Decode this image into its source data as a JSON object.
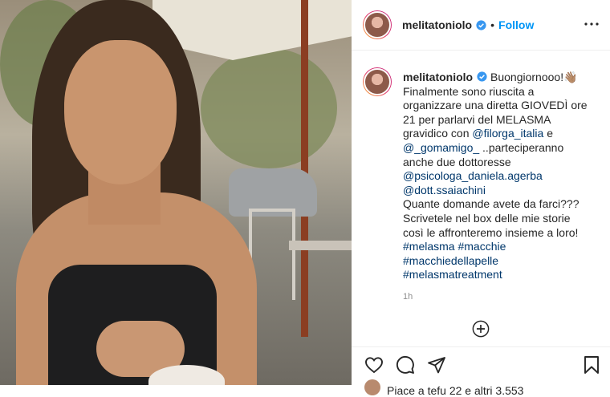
{
  "post": {
    "username": "melitatoniolo",
    "follow_label": "Follow",
    "dot": "•",
    "caption": {
      "username": "melitatoniolo",
      "line1_text": " Buongiornooo!👋🏽",
      "line2": "Finalmente sono riuscita a",
      "line3": "organizzare una diretta GIOVEDÌ ore",
      "line4": "21 per parlarvi del MELASMA",
      "line5_pre": "gravidico con ",
      "mention1": "@filorga_italia",
      "line5_post": " e",
      "mention2": "@_gomamigo_",
      "line6_post": " ..parteciperanno",
      "line7": "anche due dottoresse",
      "mention3": "@psicologa_daniela.agerba",
      "mention4": "@dott.ssaiachini",
      "line10": "Quante domande avete da farci???",
      "line11": "Scrivetele nel box delle mie storie",
      "line12": "così le affronteremo insieme a loro!",
      "hashtag1": "#melasma",
      "hashtag2": "#macchie",
      "hashtag3": "#macchiedellapelle",
      "hashtag4": "#melasmatreatment"
    },
    "time": "1h",
    "likes_text": "Piace a tefu 22 e altri 3.553"
  },
  "icons": {
    "verified": "verified-badge-icon",
    "more": "more-options-icon",
    "add": "add-comment-circle-icon",
    "like": "heart-icon",
    "comment": "comment-icon",
    "share": "paper-plane-icon",
    "save": "bookmark-icon"
  },
  "colors": {
    "link": "#0095f6",
    "mention": "#00376b",
    "muted": "#8e8e8e"
  }
}
